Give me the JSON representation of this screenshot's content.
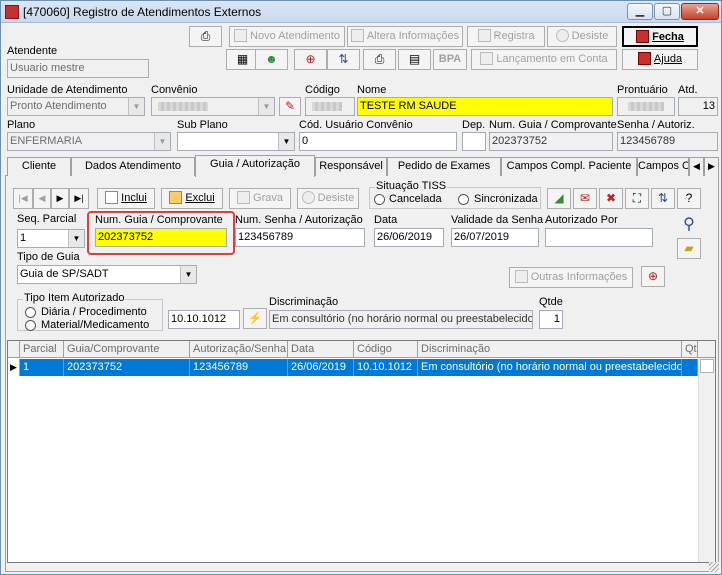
{
  "window": {
    "title": "[470060]  Registro de Atendimentos Externos",
    "min": "▁",
    "max": "▢",
    "close": "✕"
  },
  "toolbar": {
    "novo_atendimento": "Novo Atendimento",
    "altera_informacoes": "Altera Informações",
    "registra": "Registra",
    "desiste": "Desiste",
    "fecha": "Fecha",
    "bpa": "BPA",
    "lancamento_em_conta": "Lançamento em Conta",
    "ajuda": "Ajuda"
  },
  "atendente": {
    "label": "Atendente",
    "value": "Usuario mestre"
  },
  "unidade": {
    "label": "Unidade de Atendimento",
    "value": "Pronto Atendimento"
  },
  "convenio": {
    "label": "Convênio"
  },
  "codigo": {
    "label": "Código"
  },
  "nome": {
    "label": "Nome",
    "value": "TESTE RM SAUDE"
  },
  "prontuario": {
    "label": "Prontuário"
  },
  "atd": {
    "label": "Atd.",
    "value": "13"
  },
  "plano": {
    "label": "Plano",
    "value": "ENFERMARIA"
  },
  "sub_plano": {
    "label": "Sub Plano",
    "value": ""
  },
  "cod_usuario_convenio": {
    "label": "Cód. Usuário Convênio",
    "value": "0"
  },
  "dep": {
    "label": "Dep.",
    "value": ""
  },
  "num_guia_top": {
    "label": "Num. Guia / Comprovante",
    "value": "202373752"
  },
  "senha_top": {
    "label": "Senha / Autoriz.",
    "value": "123456789"
  },
  "tabs": [
    "Cliente",
    "Dados Atendimento",
    "Guia / Autorização",
    "Responsável",
    "Pedido de Exames",
    "Campos Compl. Paciente",
    "Campos C"
  ],
  "nav": {
    "first": "|◀",
    "prev": "◀",
    "next": "▶",
    "last": "▶|",
    "inclui": "Inclui",
    "exclui": "Exclui",
    "grava": "Grava",
    "desiste": "Desiste"
  },
  "situacao_tiss": {
    "label": "Situação TISS",
    "cancelada": "Cancelada",
    "sincronizada": "Sincronizada"
  },
  "seq_parcial": {
    "label": "Seq. Parcial",
    "value": "1"
  },
  "num_guia": {
    "label": "Num. Guia / Comprovante",
    "value": "202373752"
  },
  "num_senha": {
    "label": "Num. Senha / Autorização",
    "value": "123456789"
  },
  "data": {
    "label": "Data",
    "value": "26/06/2019"
  },
  "validade_senha": {
    "label": "Validade da Senha",
    "value": "26/07/2019"
  },
  "autorizado_por": {
    "label": "Autorizado Por",
    "value": ""
  },
  "tipo_guia": {
    "label": "Tipo de Guia",
    "value": "Guia de SP/SADT"
  },
  "outras_informacoes": "Outras Informações",
  "tipo_item": {
    "label": "Tipo Item Autorizado",
    "diaria": "Diária / Procedimento",
    "material": "Material/Medicamento"
  },
  "codigo_item": {
    "value": "10.10.1012"
  },
  "discriminacao": {
    "label": "Discriminação",
    "value": "Em consultório (no horário normal ou preestabelecido)"
  },
  "qtde": {
    "label": "Qtde",
    "value": "1"
  },
  "grid": {
    "headers": [
      "Parcial",
      "Guia/Comprovante",
      "Autorização/Senha",
      "Data",
      "Código",
      "Discriminação",
      "Qtd"
    ],
    "rows": [
      [
        "1",
        "202373752",
        "123456789",
        "26/06/2019",
        "10.10.1012",
        "Em consultório (no horário normal ou preestabelecido)",
        ""
      ]
    ]
  },
  "colors": {
    "highlight": "#ffff00",
    "selection": "#0078d7",
    "callout": "#d9413c"
  }
}
